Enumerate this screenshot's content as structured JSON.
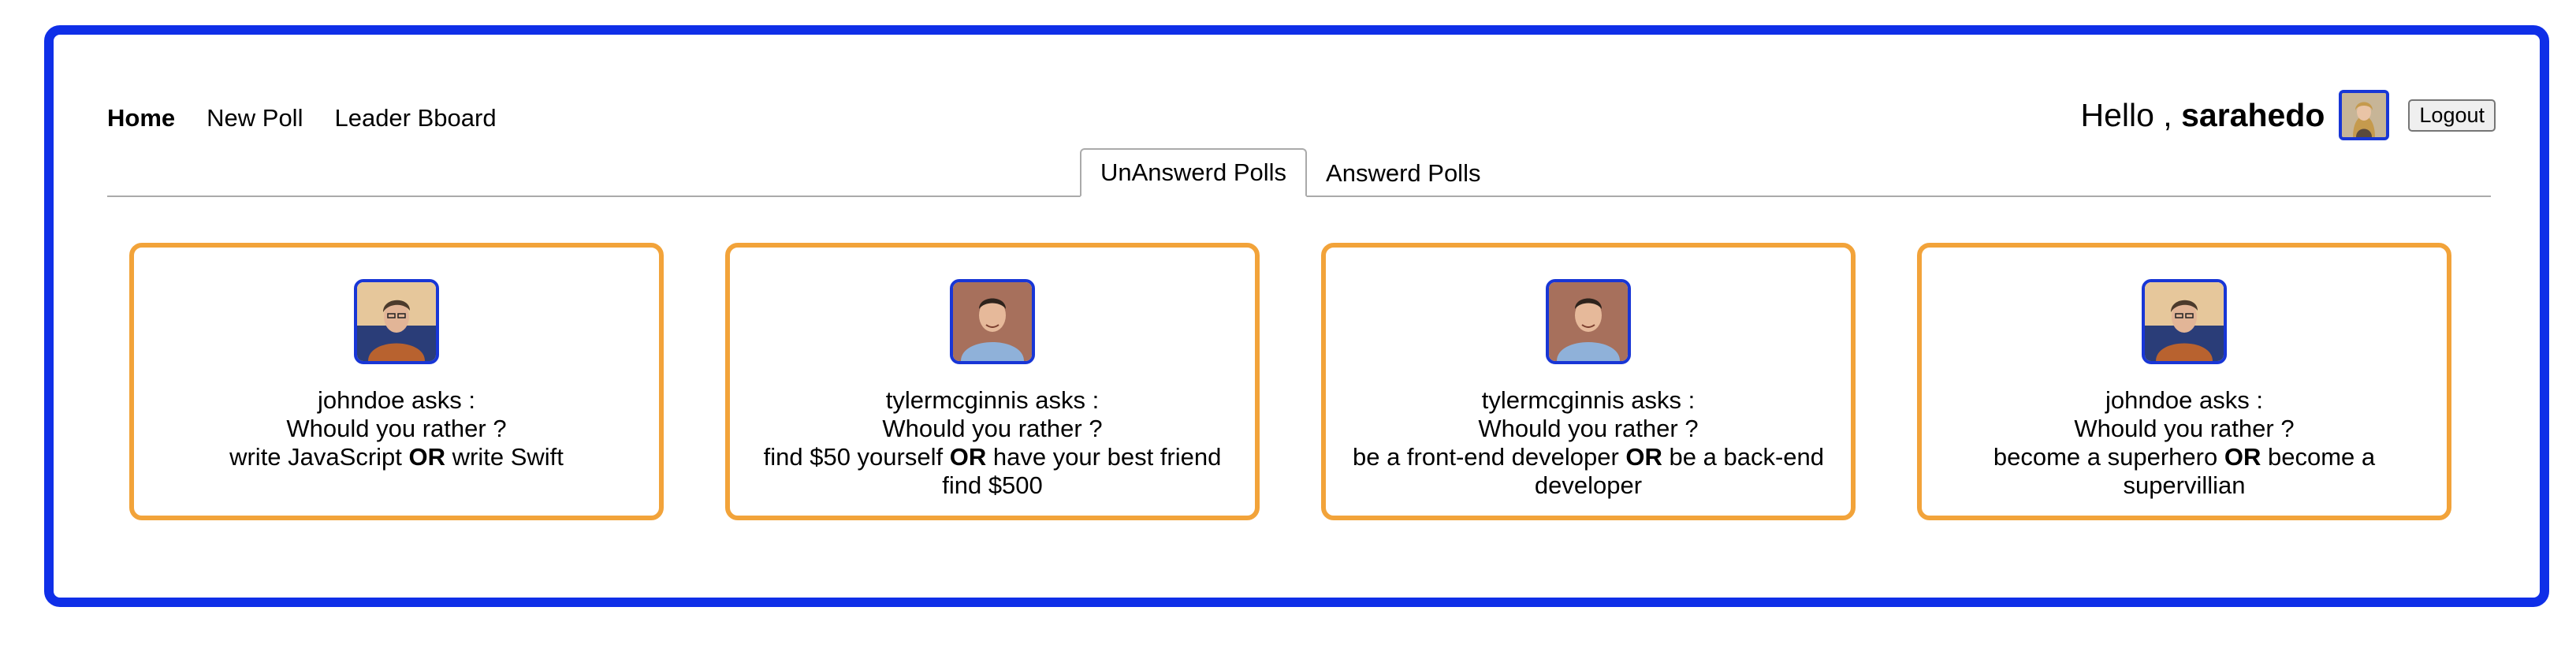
{
  "nav": {
    "items": [
      {
        "label": "Home",
        "active": true
      },
      {
        "label": "New Poll",
        "active": false
      },
      {
        "label": "Leader Bboard",
        "active": false
      }
    ]
  },
  "user": {
    "greeting": "Hello ,",
    "username": "sarahedo",
    "logout_label": "Logout"
  },
  "tabs": [
    {
      "label": "UnAnswerd Polls",
      "active": true
    },
    {
      "label": "Answerd Polls",
      "active": false
    }
  ],
  "polls": [
    {
      "author": "johndoe",
      "asks": "asks :",
      "prompt": "Whould you rather ?",
      "option_one": "write JavaScript",
      "or": "OR",
      "option_two": "write Swift"
    },
    {
      "author": "tylermcginnis",
      "asks": "asks :",
      "prompt": "Whould you rather ?",
      "option_one": "find $50 yourself",
      "or": "OR",
      "option_two": "have your best friend find $500"
    },
    {
      "author": "tylermcginnis",
      "asks": "asks :",
      "prompt": "Whould you rather ?",
      "option_one": "be a front-end developer",
      "or": "OR",
      "option_two": "be a back-end developer"
    },
    {
      "author": "johndoe",
      "asks": "asks :",
      "prompt": "Whould you rather ?",
      "option_one": "become a superhero",
      "or": "OR",
      "option_two": "become a supervillian"
    }
  ],
  "colors": {
    "frame": "#0f2fe8",
    "card_border": "#f2a33a",
    "avatar_border": "#1836d6"
  }
}
